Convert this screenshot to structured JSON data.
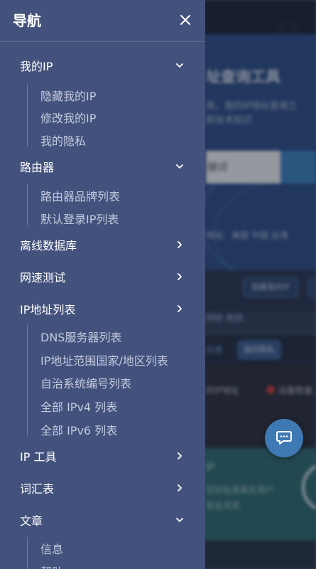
{
  "drawer": {
    "title": "导航",
    "close_icon": "close-icon",
    "items": [
      {
        "label": "我的IP",
        "expanded": true,
        "chevron": "chevron-down-icon",
        "children": [
          "隐藏我的IP",
          "修改我的IP",
          "我的隐私"
        ]
      },
      {
        "label": "路由器",
        "expanded": true,
        "chevron": "chevron-down-icon",
        "children": [
          "路由器品牌列表",
          "默认登录IP列表"
        ]
      },
      {
        "label": "离线数据库",
        "expanded": false,
        "chevron": "chevron-right-icon"
      },
      {
        "label": "网速测试",
        "expanded": false,
        "chevron": "chevron-right-icon"
      },
      {
        "label": "IP地址列表",
        "expanded": false,
        "chevron": "chevron-right-icon",
        "children": [
          "DNS服务器列表",
          "IP地址范围国家/地区列表",
          "自治系统编号列表",
          "全部 IPv4 列表",
          "全部 IPv6 列表"
        ]
      },
      {
        "label": "IP 工具",
        "expanded": false,
        "chevron": "chevron-right-icon"
      },
      {
        "label": "词汇表",
        "expanded": false,
        "chevron": "chevron-right-icon"
      },
      {
        "label": "文章",
        "expanded": true,
        "chevron": "chevron-down-icon",
        "children": [
          "信息",
          "帮助"
        ]
      }
    ]
  },
  "background_page": {
    "title": "址查询工具",
    "subtitle_1": "库。我的IP地址查询工",
    "subtitle_2": "和技术知识",
    "search_text": "键词",
    "ip_line": "地址：美国 中国 台湾",
    "chip_label": "隐藏我的IP",
    "row2_text": "网络 美国",
    "pill_text": "信息",
    "pill_label": "我的隐私",
    "list_text": "的IP地址",
    "list_text_2": "设备数量",
    "teal_title": "护",
    "teal_line_1": "您的信息真实用户",
    "teal_line_2": "安全无忧"
  },
  "chat": {
    "icon": "chat-bubble-icon"
  },
  "colors": {
    "drawer_bg": "#43527c",
    "drawer_text": "#ffffff",
    "drawer_subtext": "#c4cbe0",
    "chat_button": "#3f79b3"
  }
}
